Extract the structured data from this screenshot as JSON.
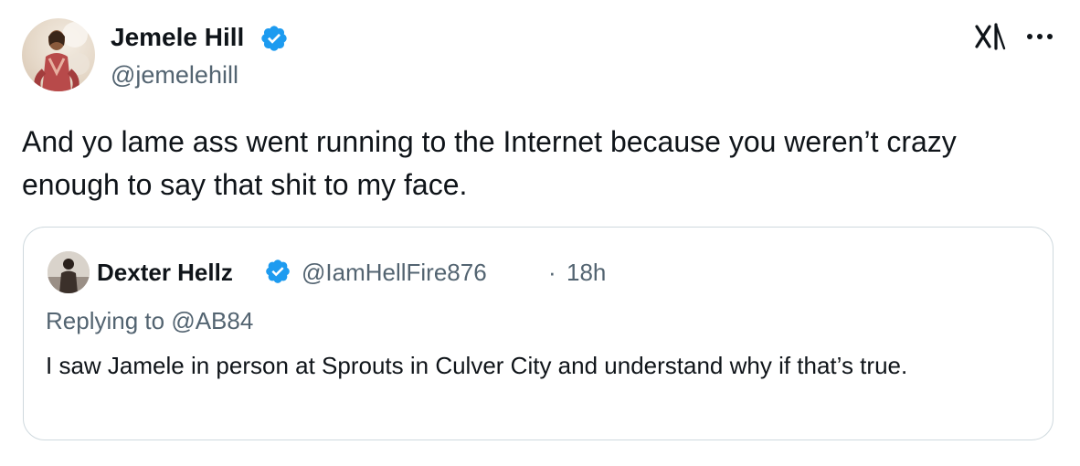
{
  "author": {
    "name": "Jemele Hill",
    "handle": "@jemelehill",
    "verified_icon": "verified-badge-icon"
  },
  "header_actions": {
    "grok_icon": "grok-icon",
    "more_icon": "more-horizontal-icon"
  },
  "tweet": {
    "text": "And yo lame ass went running to the Internet because you weren’t crazy enough to say that shit to my face."
  },
  "quote": {
    "author_name": "Dexter Hellz",
    "handle": "@IamHellFire876",
    "separator": "·",
    "time": "18h",
    "replying_prefix": "Replying to",
    "replying_to": "@AB84",
    "text": "I saw Jamele in person at Sprouts in Culver City and understand why if that’s true."
  },
  "colors": {
    "text_primary": "#0f1419",
    "text_secondary": "#536471",
    "verified_blue": "#1d9bf0",
    "link_blue": "#1d9bf0",
    "border": "#cfd9de"
  }
}
